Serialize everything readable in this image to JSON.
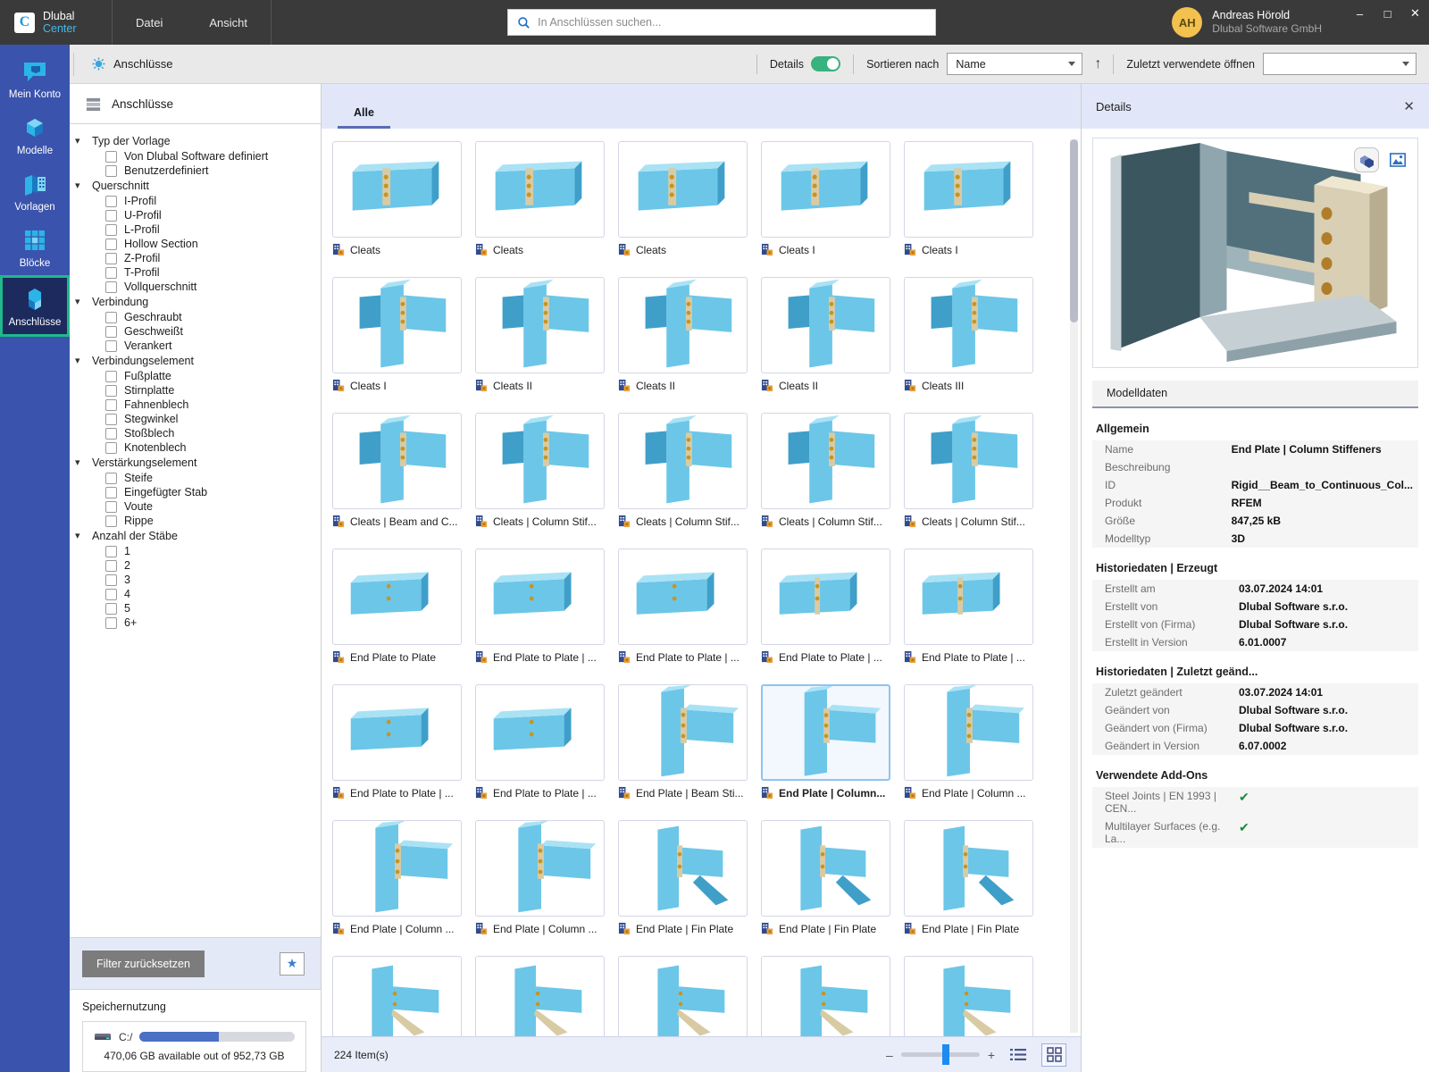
{
  "titlebar": {
    "brand_line1": "Dlubal",
    "brand_line2": "Center",
    "brand_mark": "C",
    "menu": [
      {
        "label": "Datei",
        "name": "menu-datei"
      },
      {
        "label": "Ansicht",
        "name": "menu-ansicht"
      }
    ],
    "search": {
      "placeholder": "In Anschlüssen suchen...",
      "value": "",
      "icon": "search-icon"
    },
    "user": {
      "initials": "AH",
      "name": "Andreas Hörold",
      "company": "Dlubal Software GmbH"
    },
    "window": {
      "minimize": "–",
      "maximize": "□",
      "close": "✕"
    }
  },
  "rail": {
    "items": [
      {
        "label": "Mein Konto",
        "icon": "account-speech-icon",
        "active": false
      },
      {
        "label": "Modelle",
        "icon": "cube-icon",
        "active": false
      },
      {
        "label": "Vorlagen",
        "icon": "templates-icon",
        "active": false
      },
      {
        "label": "Blöcke",
        "icon": "blocks-icon",
        "active": false
      },
      {
        "label": "Anschlüsse",
        "icon": "connections-icon",
        "active": true
      }
    ]
  },
  "breadcrumb": {
    "label": "Anschlüsse",
    "icon": "connections-small-icon"
  },
  "toolbar": {
    "details_label": "Details",
    "details_on": true,
    "sort_label": "Sortieren nach",
    "sort_value": "Name",
    "sort_direction_icon": "arrow-up-icon",
    "recent_label": "Zuletzt verwendete öffnen",
    "recent_value": ""
  },
  "filter_panel": {
    "title": "Anschlüsse",
    "title_icon": "library-icon",
    "groups": [
      {
        "label": "Typ der Vorlage",
        "items": [
          "Von Dlubal Software definiert",
          "Benutzerdefiniert"
        ]
      },
      {
        "label": "Querschnitt",
        "items": [
          "I-Profil",
          "U-Profil",
          "L-Profil",
          "Hollow Section",
          "Z-Profil",
          "T-Profil",
          "Vollquerschnitt"
        ]
      },
      {
        "label": "Verbindung",
        "items": [
          "Geschraubt",
          "Geschweißt",
          "Verankert"
        ]
      },
      {
        "label": "Verbindungselement",
        "items": [
          "Fußplatte",
          "Stirnplatte",
          "Fahnenblech",
          "Stegwinkel",
          "Stoßblech",
          "Knotenblech"
        ]
      },
      {
        "label": "Verstärkungselement",
        "items": [
          "Steife",
          "Eingefügter Stab",
          "Voute",
          "Rippe"
        ]
      },
      {
        "label": "Anzahl der Stäbe",
        "items": [
          "1",
          "2",
          "3",
          "4",
          "5",
          "6+"
        ]
      }
    ],
    "reset_button": "Filter zurücksetzen",
    "favorite_icon": "star-icon"
  },
  "storage": {
    "title": "Speichernutzung",
    "drive_icon": "drive-icon",
    "drive_label": "C:/",
    "used_percent": 51,
    "note": "470,06 GB available out of 952,73 GB"
  },
  "gallery": {
    "tabs": [
      {
        "label": "Alle",
        "active": true
      }
    ],
    "items": [
      {
        "label": "Cleats",
        "kind": "cleats-a"
      },
      {
        "label": "Cleats",
        "kind": "cleats-b"
      },
      {
        "label": "Cleats",
        "kind": "cleats-c"
      },
      {
        "label": "Cleats I",
        "kind": "cleats-d"
      },
      {
        "label": "Cleats I",
        "kind": "cleats-e"
      },
      {
        "label": "Cleats I",
        "kind": "cleats-f"
      },
      {
        "label": "Cleats II",
        "kind": "cleats-g"
      },
      {
        "label": "Cleats II",
        "kind": "cleats-h"
      },
      {
        "label": "Cleats II",
        "kind": "cleats-i"
      },
      {
        "label": "Cleats III",
        "kind": "cleats-j"
      },
      {
        "label": "Cleats | Beam and C...",
        "kind": "cleats-beam"
      },
      {
        "label": "Cleats | Column Stif...",
        "kind": "cleats-colstif-a"
      },
      {
        "label": "Cleats | Column Stif...",
        "kind": "cleats-colstif-b"
      },
      {
        "label": "Cleats | Column Stif...",
        "kind": "cleats-colstif-c"
      },
      {
        "label": "Cleats | Column Stif...",
        "kind": "cleats-colstif-d"
      },
      {
        "label": "End Plate to Plate",
        "kind": "ep-plate-a"
      },
      {
        "label": "End Plate to Plate | ...",
        "kind": "ep-plate-b"
      },
      {
        "label": "End Plate to Plate | ...",
        "kind": "ep-plate-c"
      },
      {
        "label": "End Plate to Plate | ...",
        "kind": "ep-plate-d"
      },
      {
        "label": "End Plate to Plate | ...",
        "kind": "ep-plate-e"
      },
      {
        "label": "End Plate to Plate | ...",
        "kind": "ep-plate-f"
      },
      {
        "label": "End Plate to Plate | ...",
        "kind": "ep-plate-g"
      },
      {
        "label": "End Plate | Beam Sti...",
        "kind": "ep-beamstif"
      },
      {
        "label": "End Plate | Column...",
        "kind": "ep-column-sel",
        "selected": true
      },
      {
        "label": "End Plate | Column ...",
        "kind": "ep-column-b"
      },
      {
        "label": "End Plate | Column ...",
        "kind": "ep-column-c"
      },
      {
        "label": "End Plate | Column ...",
        "kind": "ep-column-d"
      },
      {
        "label": "End Plate | Fin Plate",
        "kind": "ep-fin-a"
      },
      {
        "label": "End Plate | Fin Plate",
        "kind": "ep-fin-b"
      },
      {
        "label": "End Plate | Fin Plate",
        "kind": "ep-fin-c"
      },
      {
        "label": "",
        "kind": "row7-a"
      },
      {
        "label": "",
        "kind": "row7-b"
      },
      {
        "label": "",
        "kind": "row7-c"
      },
      {
        "label": "",
        "kind": "row7-d"
      },
      {
        "label": "",
        "kind": "row7-e"
      }
    ],
    "item_icon": "connection-file-icon"
  },
  "statusbar": {
    "count": "224 Item(s)",
    "zoom_minus": "–",
    "zoom_plus": "+",
    "zoom_value": 52,
    "list_view_icon": "list-view-icon",
    "grid_view_icon": "grid-view-icon",
    "grid_view_active": true
  },
  "details": {
    "title": "Details",
    "close_icon": "close-icon",
    "preview_tools": [
      {
        "name": "3d-view-icon"
      },
      {
        "name": "image-view-icon"
      }
    ],
    "modeldata_header": "Modelldaten",
    "sections": [
      {
        "title": "Allgemein",
        "rows": [
          {
            "k": "Name",
            "v": "End Plate | Column Stiffeners"
          },
          {
            "k": "Beschreibung",
            "v": ""
          },
          {
            "k": "ID",
            "v": "Rigid__Beam_to_Continuous_Col..."
          },
          {
            "k": "Produkt",
            "v": "RFEM"
          },
          {
            "k": "Größe",
            "v": "847,25 kB"
          },
          {
            "k": "Modelltyp",
            "v": "3D"
          }
        ]
      },
      {
        "title": "Historiedaten | Erzeugt",
        "rows": [
          {
            "k": "Erstellt am",
            "v": "03.07.2024 14:01"
          },
          {
            "k": "Erstellt von",
            "v": "Dlubal Software s.r.o."
          },
          {
            "k": "Erstellt von (Firma)",
            "v": "Dlubal Software s.r.o."
          },
          {
            "k": "Erstellt in Version",
            "v": "6.01.0007"
          }
        ]
      },
      {
        "title": "Historiedaten | Zuletzt geänd...",
        "rows": [
          {
            "k": "Zuletzt geändert",
            "v": "03.07.2024 14:01"
          },
          {
            "k": "Geändert von",
            "v": "Dlubal Software s.r.o."
          },
          {
            "k": "Geändert von (Firma)",
            "v": "Dlubal Software s.r.o."
          },
          {
            "k": "Geändert in Version",
            "v": "6.07.0002"
          }
        ]
      },
      {
        "title": "Verwendete Add-Ons",
        "addons": true,
        "rows": [
          {
            "k": "Steel Joints | EN 1993 | CEN...",
            "v": "✔"
          },
          {
            "k": "Multilayer Surfaces (e.g. La...",
            "v": "✔"
          }
        ]
      }
    ]
  },
  "colors": {
    "rail_bg": "#3a53ac",
    "accent_green": "#1fb98a",
    "toggle_on": "#36b37e",
    "tab_underline": "#5a6bb5",
    "avatar": "#f2c14e"
  }
}
